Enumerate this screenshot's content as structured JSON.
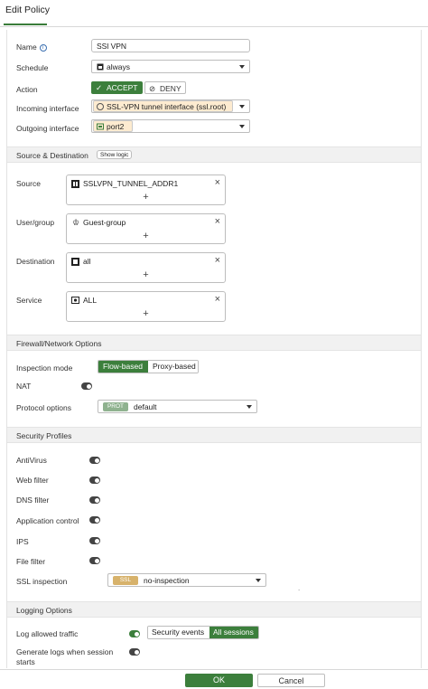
{
  "page": {
    "title": "Edit Policy"
  },
  "fields": {
    "name": {
      "label": "Name",
      "value": "SSl VPN"
    },
    "schedule": {
      "label": "Schedule",
      "value": "always"
    },
    "action": {
      "label": "Action",
      "accept": "ACCEPT",
      "deny": "DENY",
      "selected": "ACCEPT"
    },
    "incoming": {
      "label": "Incoming interface",
      "value": "SSL-VPN tunnel interface (ssl.root)"
    },
    "outgoing": {
      "label": "Outgoing interface",
      "value": "port2"
    }
  },
  "source_dest": {
    "section": "Source & Destination",
    "show_logic": "Show logic",
    "source": {
      "label": "Source",
      "item": "SSLVPN_TUNNEL_ADDR1"
    },
    "usergroup": {
      "label": "User/group",
      "item": "Guest-group"
    },
    "destination": {
      "label": "Destination",
      "item": "all"
    },
    "service": {
      "label": "Service",
      "item": "ALL"
    },
    "remove_glyph": "×",
    "add_glyph": "+"
  },
  "firewall": {
    "section": "Firewall/Network Options",
    "inspection_mode": {
      "label": "Inspection mode",
      "options": [
        "Flow-based",
        "Proxy-based"
      ],
      "selected": "Flow-based"
    },
    "nat": {
      "label": "NAT",
      "enabled": false
    },
    "protocol_options": {
      "label": "Protocol options",
      "badge": "PROT",
      "value": "default"
    }
  },
  "security": {
    "section": "Security Profiles",
    "items": [
      {
        "label": "AntiVirus",
        "enabled": false
      },
      {
        "label": "Web filter",
        "enabled": false
      },
      {
        "label": "DNS filter",
        "enabled": false
      },
      {
        "label": "Application control",
        "enabled": false
      },
      {
        "label": "IPS",
        "enabled": false
      },
      {
        "label": "File filter",
        "enabled": false
      }
    ],
    "ssl_inspection": {
      "label": "SSL inspection",
      "badge": "SSL",
      "value": "no-inspection"
    },
    "dot": "."
  },
  "logging": {
    "section": "Logging Options",
    "log_allowed": {
      "label": "Log allowed traffic",
      "enabled": true,
      "options": [
        "Security events",
        "All sessions"
      ],
      "selected": "All sessions"
    },
    "generate_logs": {
      "label": "Generate logs when session starts",
      "enabled": false
    }
  },
  "footer": {
    "ok": "OK",
    "cancel": "Cancel"
  },
  "colors": {
    "accent": "#3c7f3c",
    "chip_bg": "#fdebd0",
    "prot_badge": "#8fb28f",
    "ssl_badge": "#d7b26b"
  }
}
